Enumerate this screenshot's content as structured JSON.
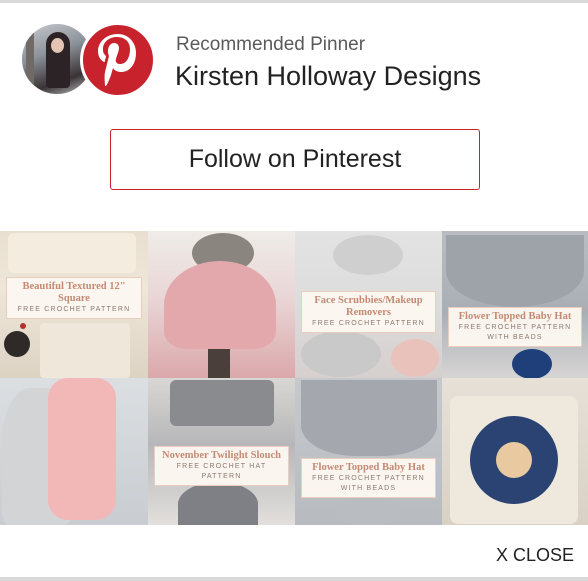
{
  "header": {
    "label": "Recommended Pinner",
    "name": "Kirsten Holloway Designs"
  },
  "follow_button": "Follow on Pinterest",
  "tiles": [
    {
      "title": "Beautiful Textured 12\" Square",
      "subtitle": "FREE CROCHET PATTERN"
    },
    {
      "title": "",
      "subtitle": ""
    },
    {
      "title": "Face Scrubbies/Makeup Removers",
      "subtitle": "FREE CROCHET PATTERN"
    },
    {
      "title": "Flower Topped Baby Hat",
      "subtitle": "FREE CROCHET PATTERN WITH BEADS"
    },
    {
      "title": "",
      "subtitle": ""
    },
    {
      "title": "November Twilight Slouch",
      "subtitle": "FREE CROCHET HAT PATTERN"
    },
    {
      "title": "Flower Topped Baby Hat",
      "subtitle": "FREE CROCHET PATTERN WITH BEADS"
    },
    {
      "title": "",
      "subtitle": ""
    }
  ],
  "close_button": "X CLOSE",
  "colors": {
    "pinterest_red": "#c8232c",
    "banner_title": "#c58a73"
  },
  "icons": [
    "avatar",
    "pinterest-logo-icon"
  ]
}
